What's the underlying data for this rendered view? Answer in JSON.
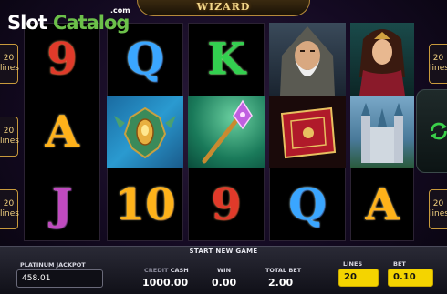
{
  "header": {
    "title": "WIZARD"
  },
  "watermark": {
    "slot": "Slot",
    "catalog": "Catalog",
    "com": ".com"
  },
  "line_markers": {
    "left": [
      {
        "num": "20",
        "word": "lines"
      },
      {
        "num": "20",
        "word": "lines"
      },
      {
        "num": "20",
        "word": "lines"
      }
    ],
    "right": [
      {
        "num": "20",
        "word": "lines"
      },
      {
        "num": "20",
        "word": "lines"
      }
    ]
  },
  "reels": [
    [
      "9",
      "A",
      "J"
    ],
    [
      "Q",
      "beetle-symbol",
      "10"
    ],
    [
      "K",
      "magic-staff-symbol",
      "9"
    ],
    [
      "wizard-symbol",
      "spellbook-symbol",
      "Q"
    ],
    [
      "sorceress-symbol",
      "castle-symbol",
      "A"
    ]
  ],
  "status": {
    "message": "START NEW GAME"
  },
  "jackpot": {
    "label": "PLATINUM JACKPOT",
    "value": "458.01"
  },
  "credit": {
    "label_dim": "CREDIT",
    "label": "CASH",
    "value": "1000.00"
  },
  "win": {
    "label": "WIN",
    "value": "0.00"
  },
  "total_bet": {
    "label": "TOTAL BET",
    "value": "2.00"
  },
  "lines": {
    "label": "LINES",
    "value": "20"
  },
  "bet": {
    "label": "BET",
    "value": "0.10"
  },
  "colors": {
    "accent_yellow": "#f4d400",
    "frame_gold": "#c89a3c",
    "watermark_green": "#6cc04a"
  }
}
